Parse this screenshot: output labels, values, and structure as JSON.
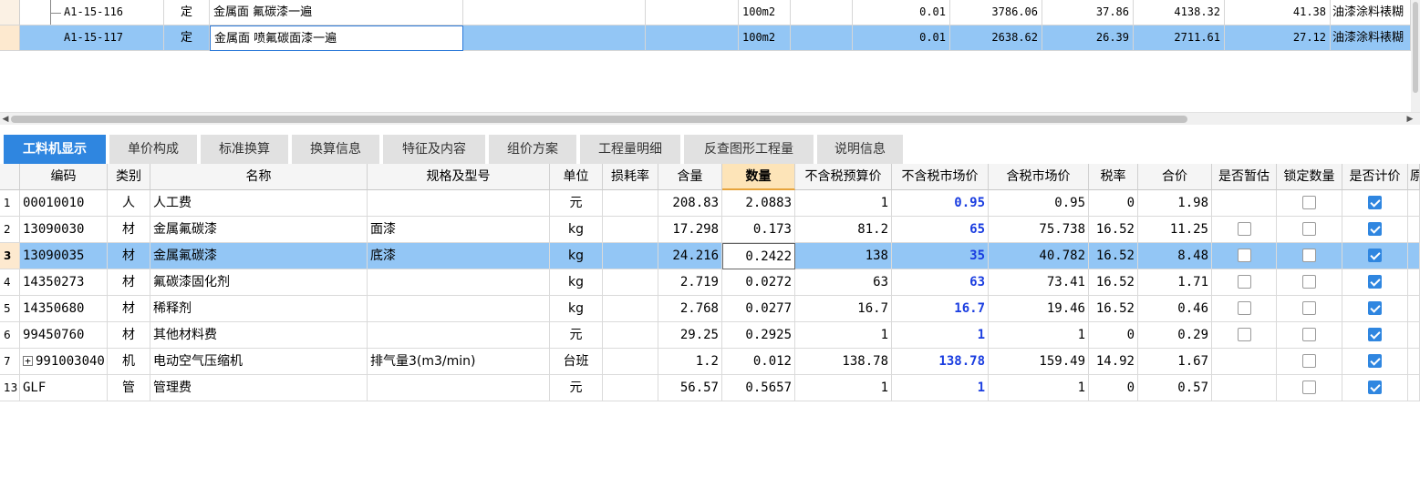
{
  "top_rows": [
    {
      "code": "A1-15-116",
      "type": "定",
      "name": "金属面 氟碳漆一遍",
      "spec": "",
      "unit_extra": "",
      "unit": "100m2",
      "extra": "",
      "qty": "0.01",
      "price": "3786.06",
      "total": "37.86",
      "price2": "4138.32",
      "total2": "41.38",
      "category": "油漆涂料裱糊"
    },
    {
      "code": "A1-15-117",
      "type": "定",
      "name": "金属面 喷氟碳面漆一遍",
      "spec": "",
      "unit_extra": "",
      "unit": "100m2",
      "extra": "",
      "qty": "0.01",
      "price": "2638.62",
      "total": "26.39",
      "price2": "2711.61",
      "total2": "27.12",
      "category": "油漆涂料裱糊"
    }
  ],
  "tabs": [
    {
      "label": "工料机显示"
    },
    {
      "label": "单价构成"
    },
    {
      "label": "标准换算"
    },
    {
      "label": "换算信息"
    },
    {
      "label": "特征及内容"
    },
    {
      "label": "组价方案"
    },
    {
      "label": "工程量明细"
    },
    {
      "label": "反查图形工程量"
    },
    {
      "label": "说明信息"
    }
  ],
  "columns": [
    "编码",
    "类别",
    "名称",
    "规格及型号",
    "单位",
    "损耗率",
    "含量",
    "数量",
    "不含税预算价",
    "不含税市场价",
    "含税市场价",
    "税率",
    "合价",
    "是否暂估",
    "锁定数量",
    "是否计价",
    "原"
  ],
  "rows": [
    {
      "rn": "1",
      "code": "00010010",
      "cat": "人",
      "name": "人工费",
      "spec": "",
      "unit": "元",
      "loss": "",
      "content": "208.83",
      "qty": "2.0883",
      "budget": "1",
      "market": "0.95",
      "taxmarket": "0.95",
      "rate": "0",
      "total": "1.98",
      "est": "",
      "lock": false,
      "priced": true
    },
    {
      "rn": "2",
      "code": "13090030",
      "cat": "材",
      "name": "金属氟碳漆",
      "spec": "面漆",
      "unit": "kg",
      "loss": "",
      "content": "17.298",
      "qty": "0.173",
      "budget": "81.2",
      "market": "65",
      "taxmarket": "75.738",
      "rate": "16.52",
      "total": "11.25",
      "est": "box",
      "lock": false,
      "priced": true
    },
    {
      "rn": "3",
      "code": "13090035",
      "cat": "材",
      "name": "金属氟碳漆",
      "spec": "底漆",
      "unit": "kg",
      "loss": "",
      "content": "24.216",
      "qty": "0.2422",
      "budget": "138",
      "market": "35",
      "taxmarket": "40.782",
      "rate": "16.52",
      "total": "8.48",
      "est": "box",
      "lock": false,
      "priced": true
    },
    {
      "rn": "4",
      "code": "14350273",
      "cat": "材",
      "name": "氟碳漆固化剂",
      "spec": "",
      "unit": "kg",
      "loss": "",
      "content": "2.719",
      "qty": "0.0272",
      "budget": "63",
      "market": "63",
      "taxmarket": "73.41",
      "rate": "16.52",
      "total": "1.71",
      "est": "box",
      "lock": false,
      "priced": true
    },
    {
      "rn": "5",
      "code": "14350680",
      "cat": "材",
      "name": "稀释剂",
      "spec": "",
      "unit": "kg",
      "loss": "",
      "content": "2.768",
      "qty": "0.0277",
      "budget": "16.7",
      "market": "16.7",
      "taxmarket": "19.46",
      "rate": "16.52",
      "total": "0.46",
      "est": "box",
      "lock": false,
      "priced": true
    },
    {
      "rn": "6",
      "code": "99450760",
      "cat": "材",
      "name": "其他材料费",
      "spec": "",
      "unit": "元",
      "loss": "",
      "content": "29.25",
      "qty": "0.2925",
      "budget": "1",
      "market": "1",
      "taxmarket": "1",
      "rate": "0",
      "total": "0.29",
      "est": "box",
      "lock": false,
      "priced": true
    },
    {
      "rn": "7",
      "code": "991003040",
      "cat": "机",
      "name": "电动空气压缩机",
      "spec": "排气量3(m3/min)",
      "unit": "台班",
      "loss": "",
      "content": "1.2",
      "qty": "0.012",
      "budget": "138.78",
      "market": "138.78",
      "taxmarket": "159.49",
      "rate": "14.92",
      "total": "1.67",
      "est": "",
      "lock": false,
      "priced": true,
      "expand": "+"
    },
    {
      "rn": "13",
      "code": "GLF",
      "cat": "管",
      "name": "管理费",
      "spec": "",
      "unit": "元",
      "loss": "",
      "content": "56.57",
      "qty": "0.5657",
      "budget": "1",
      "market": "1",
      "taxmarket": "1",
      "rate": "0",
      "total": "0.57",
      "est": "",
      "lock": false,
      "priced": true
    }
  ],
  "colors": {
    "selection": "#93c6f5",
    "accent": "#2f86e0",
    "blue_text": "#1a3de0"
  }
}
